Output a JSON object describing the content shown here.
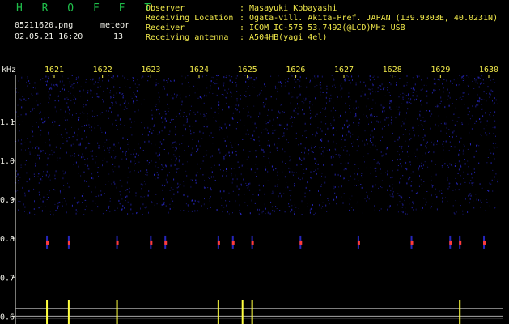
{
  "header": {
    "app_title": "H R O F F T",
    "filename": "05211620.png",
    "datetime": "02.05.21 16:20",
    "meteor_label": "meteor",
    "meteor_count": "13",
    "info": [
      {
        "label": "Observer",
        "value": ": Masayuki Kobayashi"
      },
      {
        "label": "Receiving Location",
        "value": ": Ogata-vill. Akita-Pref. JAPAN (139.9303E, 40.0231N)"
      },
      {
        "label": "Receiver",
        "value": ": ICOM IC-575 53.7492(@LCD)MHz USB"
      },
      {
        "label": "Receiving antenna",
        "value": ": A504HB(yagi 4el)"
      }
    ]
  },
  "colors": {
    "background": "#000000",
    "header_text": "#f2f2ea",
    "info_text": "#f0e84a",
    "logo": "#1fbf4a",
    "noise": "#2a2ad0",
    "echo": "#ff3c3c",
    "signal": "#ffff40",
    "ref_lines": "#a8a8a8"
  },
  "chart_data": {
    "type": "heatmap",
    "y_unit": "kHz",
    "x_ticks": [
      "1621",
      "1622",
      "1623",
      "1624",
      "1625",
      "1626",
      "1627",
      "1628",
      "1629",
      "1630"
    ],
    "y_ticks": [
      "1.1",
      "1.0",
      "0.9",
      "0.8",
      "0.7",
      "0.6"
    ],
    "y_range": [
      0.58,
      1.22
    ],
    "meteor_echo_freq_khz": 0.79,
    "meteor_echo_minutes": [
      1620.85,
      1621.3,
      1622.3,
      1623.0,
      1623.3,
      1624.4,
      1624.7,
      1625.1,
      1626.1,
      1627.3,
      1628.4,
      1629.2,
      1629.4,
      1629.9
    ],
    "signal_strength_minutes": [
      1620.85,
      1621.3,
      1622.3,
      1624.4,
      1624.9,
      1625.1,
      1629.4
    ]
  }
}
